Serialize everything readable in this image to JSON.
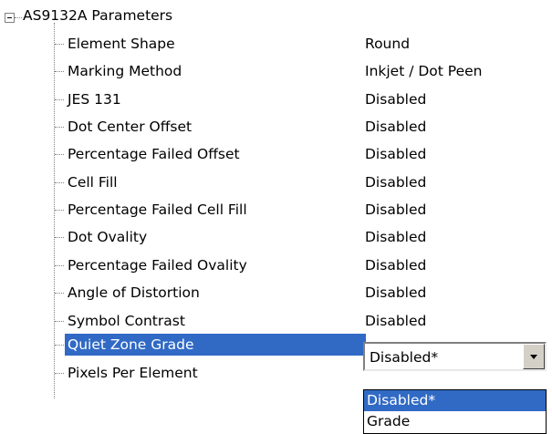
{
  "tree": {
    "root_label": "AS9132A Parameters",
    "rows": [
      {
        "label": "Element Shape",
        "value": "Round"
      },
      {
        "label": "Marking Method",
        "value": "Inkjet / Dot Peen"
      },
      {
        "label": "JES 131",
        "value": "Disabled"
      },
      {
        "label": "Dot Center Offset",
        "value": "Disabled"
      },
      {
        "label": "Percentage Failed Offset",
        "value": "Disabled"
      },
      {
        "label": "Cell Fill",
        "value": "Disabled"
      },
      {
        "label": "Percentage Failed Cell Fill",
        "value": "Disabled"
      },
      {
        "label": "Dot Ovality",
        "value": "Disabled"
      },
      {
        "label": "Percentage Failed Ovality",
        "value": "Disabled"
      },
      {
        "label": "Angle of Distortion",
        "value": "Disabled"
      },
      {
        "label": "Symbol Contrast",
        "value": "Disabled"
      },
      {
        "label": "Quiet Zone Grade",
        "value": "Disabled*"
      },
      {
        "label": "Pixels Per Element",
        "value": ""
      }
    ]
  },
  "editor": {
    "selected_value": "Disabled*",
    "options": [
      "Disabled*",
      "Grade"
    ]
  },
  "colors": {
    "selection": "#316ac5",
    "selection_text": "#ffffff",
    "tree_lines": "#808080"
  },
  "icons": {
    "expander": "minus-box-icon",
    "dropdown": "chevron-down-icon"
  }
}
